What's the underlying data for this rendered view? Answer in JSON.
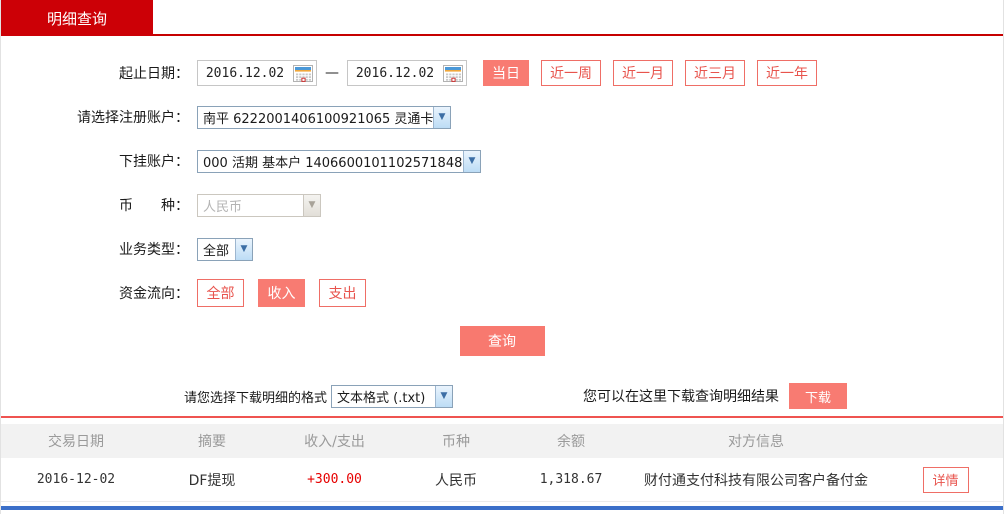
{
  "tab": {
    "title": "明细查询"
  },
  "form": {
    "date_row": {
      "label": "起止日期：",
      "start_date": "2016.12.02",
      "end_date": "2016.12.02",
      "separator": "—",
      "quick_buttons": [
        {
          "label": "当日",
          "active": true
        },
        {
          "label": "近一周",
          "active": false
        },
        {
          "label": "近一月",
          "active": false
        },
        {
          "label": "近三月",
          "active": false
        },
        {
          "label": "近一年",
          "active": false
        }
      ]
    },
    "registered_account": {
      "label": "请选择注册账户：",
      "value": "南平 6222001406100921065 灵通卡"
    },
    "linked_account": {
      "label": "下挂账户：",
      "value": "000 活期 基本户 1406600101102571848"
    },
    "currency": {
      "label": "币　　种：",
      "value": "人民币",
      "disabled": true
    },
    "business_type": {
      "label": "业务类型：",
      "value": "全部"
    },
    "fund_flow": {
      "label": "资金流向：",
      "options": [
        {
          "label": "全部",
          "active": false
        },
        {
          "label": "收入",
          "active": true
        },
        {
          "label": "支出",
          "active": false
        }
      ]
    },
    "query_button": "查询"
  },
  "download": {
    "label": "请您选择下载明细的格式",
    "format_value": "文本格式 (.txt)",
    "hint": "您可以在这里下载查询明细结果",
    "button": "下载"
  },
  "table": {
    "headers": [
      "交易日期",
      "摘要",
      "收入/支出",
      "币种",
      "余额",
      "对方信息"
    ],
    "rows": [
      {
        "date": "2016-12-02",
        "summary": "DF提现",
        "amount": "+300.00",
        "currency": "人民币",
        "balance": "1,318.67",
        "counterparty": "财付通支付科技有限公司客户备付金",
        "detail_button": "详情"
      }
    ]
  },
  "colors": {
    "tab_red": "#cc0006",
    "accent_salmon": "#f8796f",
    "outline_red": "#ef6e66",
    "amount_red": "#e60000",
    "divider_red": "#ef5350",
    "bottom_blue": "#3b6fc9",
    "header_gray": "#f2f2f2"
  }
}
